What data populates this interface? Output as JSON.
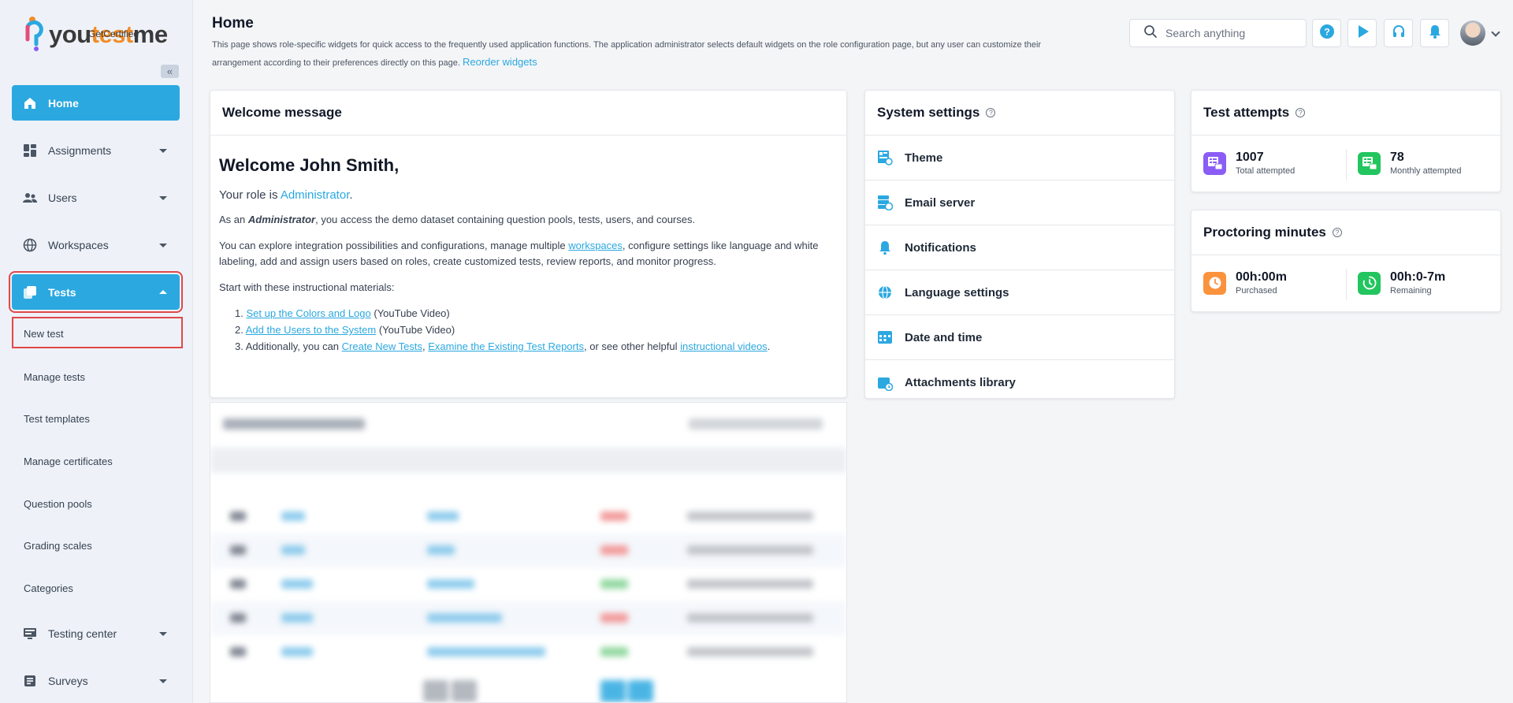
{
  "brand": {
    "name_main": "youtestme",
    "name_accent": "test",
    "tagline": "GetCertified"
  },
  "sidebar": {
    "collapse_symbol": "«",
    "items": [
      {
        "label": "Home",
        "icon": "home-icon"
      },
      {
        "label": "Assignments",
        "icon": "assignments-icon"
      },
      {
        "label": "Users",
        "icon": "users-icon"
      },
      {
        "label": "Workspaces",
        "icon": "globe-icon"
      },
      {
        "label": "Tests",
        "icon": "tests-icon"
      },
      {
        "label": "Testing center",
        "icon": "monitor-icon"
      },
      {
        "label": "Surveys",
        "icon": "surveys-icon"
      }
    ],
    "sub_items": [
      "New test",
      "Manage tests",
      "Test templates",
      "Manage certificates",
      "Question pools",
      "Grading scales",
      "Categories"
    ]
  },
  "header": {
    "title": "Home",
    "description": "This page shows role-specific widgets for quick access to the frequently used application functions. The application administrator selects default widgets on the role configuration page, but any user can customize their arrangement according to their preferences directly on this page.",
    "reorder_link": "Reorder widgets",
    "search_placeholder": "Search anything"
  },
  "welcome": {
    "title": "Welcome message",
    "heading": "Welcome John Smith,",
    "role_prefix": "Your role is ",
    "role": "Administrator",
    "role_suffix": ".",
    "p1_a": "As an ",
    "p1_role": "Administrator",
    "p1_b": ", you access the demo dataset containing question pools, tests, users, and courses.",
    "p2_a": "You can explore integration possibilities and configurations, manage multiple ",
    "p2_link": "workspaces",
    "p2_b": ", configure settings like language and white labeling, add and assign users based on roles, create customized tests, review reports, and monitor progress.",
    "p3": "Start with these instructional materials:",
    "step1_num": "1.",
    "step1_link": "Set up the Colors and Logo",
    "step1_suffix": " (YouTube Video)",
    "step2_num": "2.",
    "step2_link": "Add the Users to the System",
    "step2_suffix": " (YouTube Video)",
    "step3_num": "3.",
    "step3_a": "Additionally, you can ",
    "step3_link1": "Create New Tests",
    "step3_sep": ", ",
    "step3_link2": "Examine the Existing Test Reports",
    "step3_b": ", or see other helpful ",
    "step3_link3": "instructional videos",
    "step3_end": "."
  },
  "system_settings": {
    "title": "System settings",
    "items": [
      {
        "label": "Theme",
        "icon": "theme-icon"
      },
      {
        "label": "Email server",
        "icon": "email-server-icon"
      },
      {
        "label": "Notifications",
        "icon": "bell-icon"
      },
      {
        "label": "Language settings",
        "icon": "globe-icon"
      },
      {
        "label": "Date and time",
        "icon": "calendar-icon"
      },
      {
        "label": "Attachments library",
        "icon": "attachments-icon"
      }
    ]
  },
  "test_attempts": {
    "title": "Test attempts",
    "total_value": "1007",
    "total_label": "Total attempted",
    "monthly_value": "78",
    "monthly_label": "Monthly attempted",
    "colors": {
      "total": "#8b5cf6",
      "monthly": "#22c55e"
    }
  },
  "proctoring": {
    "title": "Proctoring minutes",
    "purchased_value": "00h:00m",
    "purchased_label": "Purchased",
    "remaining_value": "00h:0-7m",
    "remaining_label": "Remaining",
    "colors": {
      "purchased": "#fb923c",
      "remaining": "#22c55e"
    }
  },
  "theme": {
    "accent": "#2ba8e0",
    "highlight": "#e04848"
  }
}
